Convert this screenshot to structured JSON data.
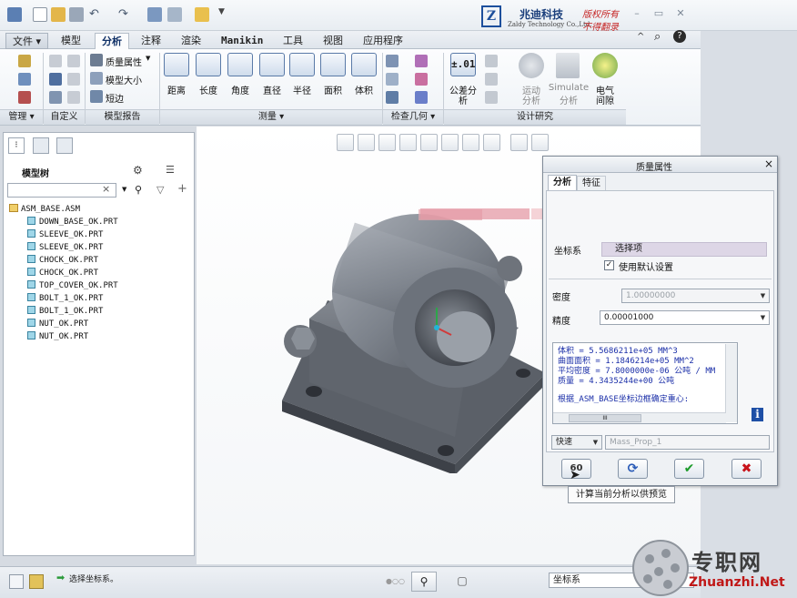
{
  "brand": {
    "logo_letter": "Z",
    "name_cn": "兆迪科技",
    "name_en": "Zaldy Technology Co.,Ltd.",
    "note_line1": "版权所有",
    "note_line2": "不得翻录"
  },
  "tabs": [
    "文件",
    "模型",
    "分析",
    "注释",
    "渲染",
    "Manikin",
    "工具",
    "视图",
    "应用程序"
  ],
  "active_tab": "分析",
  "ribbon": {
    "mass_props": "质量属性",
    "model_size": "模型大小",
    "short_edge": "短边",
    "distance": "距离",
    "length": "长度",
    "angle": "角度",
    "diameter": "直径",
    "radius": "半径",
    "area": "面积",
    "volume": "体积",
    "tolerance_value": "±.01",
    "tolerance_line1": "公差分",
    "tolerance_line2": "析",
    "motion_line1": "运动",
    "motion_line2": "分析",
    "simulate_line1": "Simulate",
    "simulate_line2": "分析",
    "electric_line1": "电气",
    "electric_line2": "间隙",
    "groups": {
      "manage": "管理",
      "custom": "自定义",
      "model_report": "模型报告",
      "measure": "测量",
      "inspect": "检查几何",
      "design_study": "设计研究"
    }
  },
  "tree": {
    "header": "模型树",
    "search_value": "",
    "clear_glyph": "×",
    "items": [
      "ASM_BASE.ASM",
      "DOWN_BASE_OK.PRT",
      "SLEEVE_OK.PRT",
      "SLEEVE_OK.PRT",
      "CHOCK_OK.PRT",
      "CHOCK_OK.PRT",
      "TOP_COVER_OK.PRT",
      "BOLT_1_OK.PRT",
      "BOLT_1_OK.PRT",
      "NUT_OK.PRT",
      "NUT_OK.PRT"
    ]
  },
  "dialog": {
    "title": "质量属性",
    "close_glyph": "×",
    "tab_analysis": "分析",
    "tab_feature": "特征",
    "coord_label": "坐标系",
    "select_item": "选择项",
    "use_default": "使用默认设置",
    "density_label": "密度",
    "density_value": "1.00000000",
    "precision_label": "精度",
    "precision_value": "0.00001000",
    "results": [
      "体积 =  5.5686211e+05  MM^3",
      "曲面面积 =  1.1846214e+05  MM^2",
      "平均密度 =  7.8000000e-06 公吨 / MM",
      "质量 =  4.3435244e+00 公吨"
    ],
    "result_note": "根据_ASM_BASE坐标边框确定重心:",
    "scroll_thumb": "III",
    "info_glyph": "i",
    "mode": "快速",
    "name_value": "Mass_Prop_1",
    "ok_glyph": "✔",
    "cancel_glyph": "✖",
    "refresh_glyph": "⟳",
    "preview_glyph": "60"
  },
  "tooltip": "计算当前分析以供预览",
  "status": {
    "message": "选择坐标系。",
    "filter_value": "坐标系"
  },
  "watermark": {
    "cn": "专职网",
    "url": "Zhuanzhi.Net"
  },
  "colors": {
    "ribbon_accent": "#1d4f9c",
    "confirm_green": "#1c9b2a",
    "cancel_red": "#c8141b",
    "result_blue": "#1b2fa8"
  }
}
